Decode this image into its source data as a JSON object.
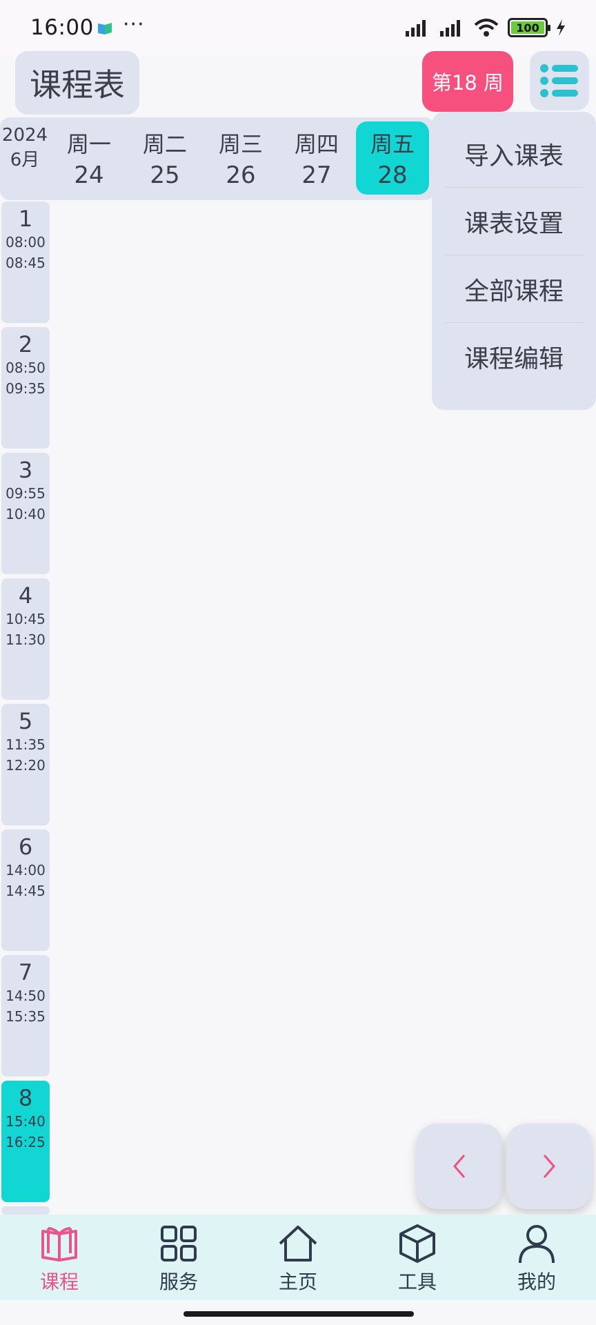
{
  "status": {
    "time": "16:00",
    "battery": "100"
  },
  "header": {
    "title": "课程表",
    "week_badge": "第18 周"
  },
  "calendar": {
    "year": "2024",
    "month": "6月",
    "days": [
      {
        "name": "周一",
        "date": "24"
      },
      {
        "name": "周二",
        "date": "25"
      },
      {
        "name": "周三",
        "date": "26"
      },
      {
        "name": "周四",
        "date": "27"
      },
      {
        "name": "周五",
        "date": "28"
      }
    ]
  },
  "periods": [
    {
      "num": "1",
      "start": "08:00",
      "end": "08:45"
    },
    {
      "num": "2",
      "start": "08:50",
      "end": "09:35"
    },
    {
      "num": "3",
      "start": "09:55",
      "end": "10:40"
    },
    {
      "num": "4",
      "start": "10:45",
      "end": "11:30"
    },
    {
      "num": "5",
      "start": "11:35",
      "end": "12:20"
    },
    {
      "num": "6",
      "start": "14:00",
      "end": "14:45"
    },
    {
      "num": "7",
      "start": "14:50",
      "end": "15:35"
    },
    {
      "num": "8",
      "start": "15:40",
      "end": "16:25"
    }
  ],
  "menu": {
    "items": [
      "导入课表",
      "课表设置",
      "全部课程",
      "课程编辑"
    ]
  },
  "bottom_nav": {
    "items": [
      "课程",
      "服务",
      "主页",
      "工具",
      "我的"
    ]
  },
  "colors": {
    "accent_pink": "#f6507e",
    "accent_teal": "#12d6d3",
    "panel": "#dee3ef"
  }
}
